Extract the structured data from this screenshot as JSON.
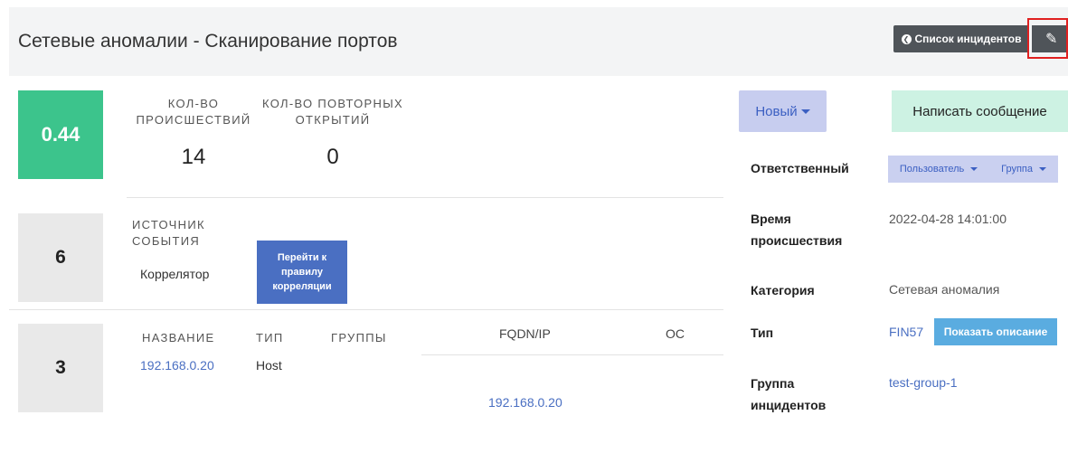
{
  "header": {
    "title": "Сетевые аномалии - Сканирование портов",
    "list_button_label": "Список инцидентов",
    "list_icon_glyph": "❮",
    "edit_icon_glyph": "✎",
    "highlight_color": "#e02020"
  },
  "summary": {
    "score": "0.44",
    "score_color": "#3cc48c",
    "incidents_caption": "КОЛ-ВО ПРОИСШЕСТВИЙ",
    "incidents_count": "14",
    "reopen_caption": "КОЛ-ВО ПОВТОРНЫХ ОТКРЫТИЙ",
    "reopen_count": "0"
  },
  "source": {
    "count": "6",
    "caption": "ИСТОЧНИК СОБЫТИЯ",
    "value": "Коррелятор",
    "rule_button_label": "Перейти к правилу корреляции"
  },
  "assets": {
    "count": "3",
    "columns": {
      "name": "НАЗВАНИЕ",
      "type": "ТИП",
      "groups": "ГРУППЫ",
      "fqdn": "FQDN/IP",
      "os": "ОС"
    },
    "row": {
      "name": "192.168.0.20",
      "type": "Host",
      "groups": "",
      "fqdn": "192.168.0.20",
      "os": ""
    }
  },
  "side": {
    "status_label": "Новый",
    "message_button_label": "Написать сообщение",
    "responsible_label": "Ответственный",
    "user_dropdown_label": "Пользователь",
    "group_dropdown_label": "Группа",
    "time_label": "Время происшествия",
    "time_value": "2022-04-28 14:01:00",
    "category_label": "Категория",
    "category_value": "Сетевая аномалия",
    "type_label": "Тип",
    "type_value": "FIN57",
    "show_description_label": "Показать описание",
    "incident_group_label": "Группа инцидентов",
    "incident_group_value": "test-group-1"
  }
}
